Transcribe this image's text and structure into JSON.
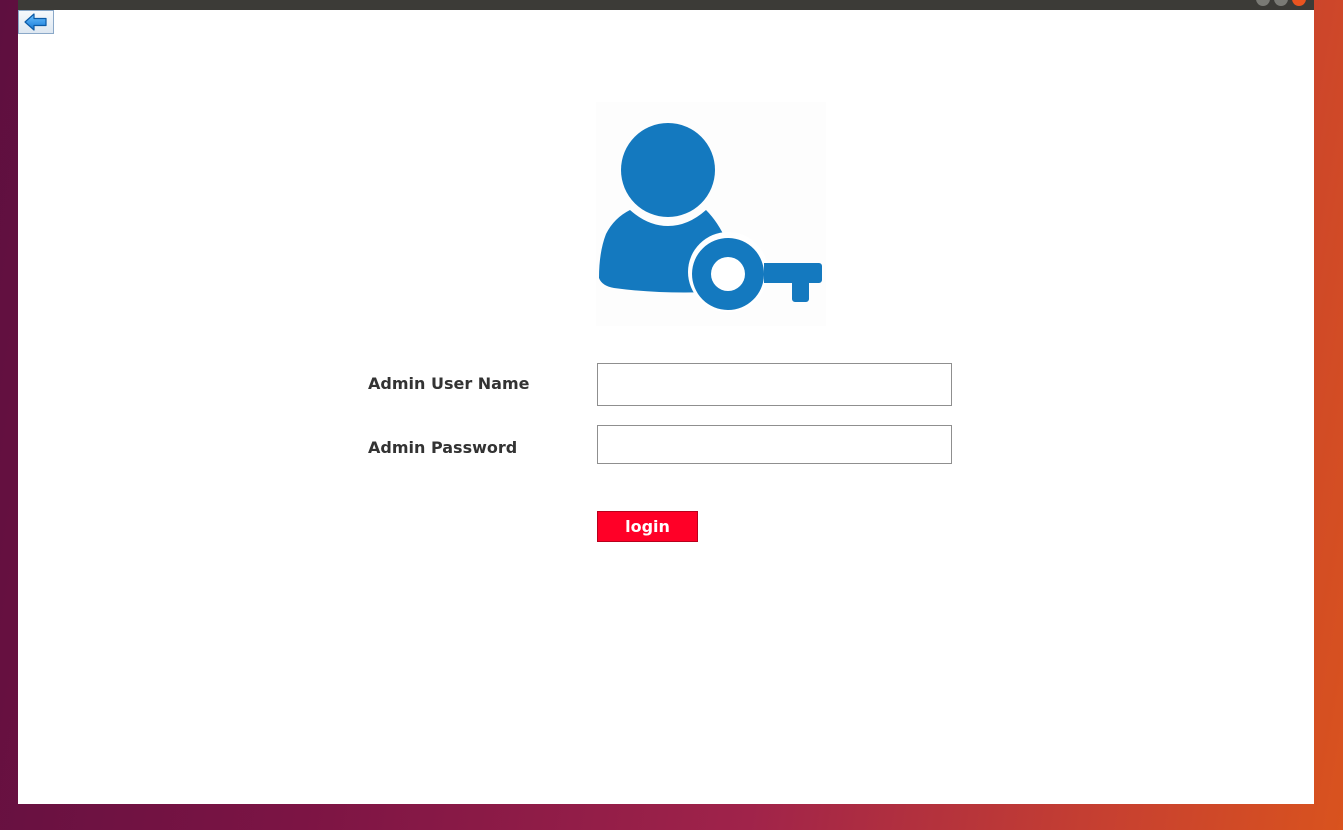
{
  "colors": {
    "accent_icon": "#1479bf",
    "login_button_bg": "#ff0027",
    "label_text": "#333333"
  },
  "icons": {
    "back": "back-arrow-icon",
    "admin": "admin-user-key-icon"
  },
  "form": {
    "username_label": "Admin User Name",
    "username_value": "",
    "password_label": "Admin Password",
    "password_value": "",
    "login_label": "login"
  }
}
